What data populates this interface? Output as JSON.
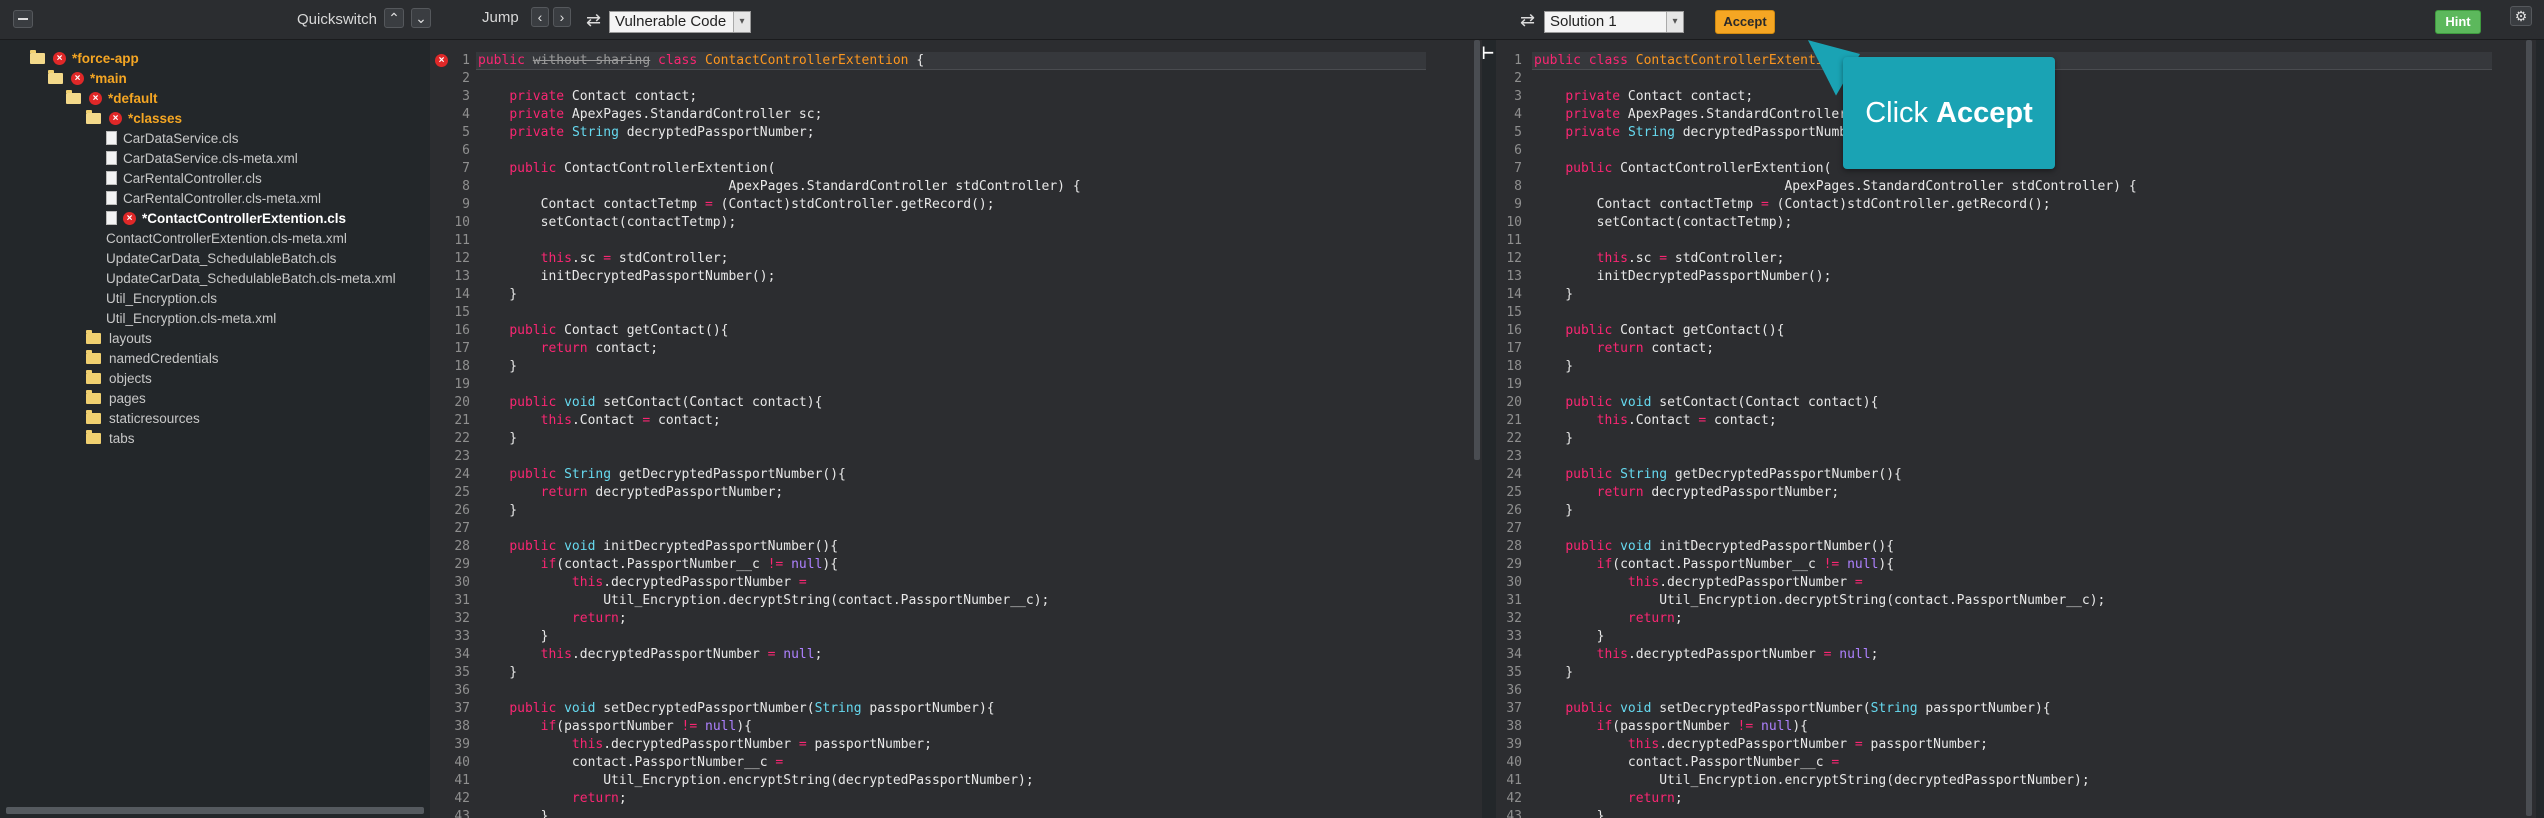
{
  "toolbar": {
    "quickswitch_label": "Quickswitch",
    "jump_label": "Jump",
    "left_select": "Vulnerable Code",
    "right_select": "Solution 1",
    "accept_label": "Accept",
    "hint_label": "Hint"
  },
  "tree": {
    "nodes": [
      {
        "label": "*force-app",
        "depth": 0,
        "kind": "folder",
        "modified": true
      },
      {
        "label": "*main",
        "depth": 1,
        "kind": "folder",
        "modified": true
      },
      {
        "label": "*default",
        "depth": 2,
        "kind": "folder",
        "modified": true
      },
      {
        "label": "*classes",
        "depth": 3,
        "kind": "folder",
        "modified": true
      },
      {
        "label": "CarDataService.cls",
        "depth": 4,
        "kind": "file"
      },
      {
        "label": "CarDataService.cls-meta.xml",
        "depth": 4,
        "kind": "file"
      },
      {
        "label": "CarRentalController.cls",
        "depth": 4,
        "kind": "file"
      },
      {
        "label": "CarRentalController.cls-meta.xml",
        "depth": 4,
        "kind": "file"
      },
      {
        "label": "*ContactControllerExtention.cls",
        "depth": 4,
        "kind": "file",
        "modified": true,
        "active": true
      },
      {
        "label": "ContactControllerExtention.cls-meta.xml",
        "depth": 4,
        "kind": "plain"
      },
      {
        "label": "UpdateCarData_SchedulableBatch.cls",
        "depth": 4,
        "kind": "plain"
      },
      {
        "label": "UpdateCarData_SchedulableBatch.cls-meta.xml",
        "depth": 4,
        "kind": "plain"
      },
      {
        "label": "Util_Encryption.cls",
        "depth": 4,
        "kind": "plain"
      },
      {
        "label": "Util_Encryption.cls-meta.xml",
        "depth": 4,
        "kind": "plain"
      },
      {
        "label": "layouts",
        "depth": 3,
        "kind": "folder"
      },
      {
        "label": "namedCredentials",
        "depth": 3,
        "kind": "folder"
      },
      {
        "label": "objects",
        "depth": 3,
        "kind": "folder"
      },
      {
        "label": "pages",
        "depth": 3,
        "kind": "folder"
      },
      {
        "label": "staticresources",
        "depth": 3,
        "kind": "folder"
      },
      {
        "label": "tabs",
        "depth": 3,
        "kind": "folder"
      }
    ]
  },
  "callout": {
    "prefix": "Click",
    "action": "Accept"
  },
  "left_code": [
    [
      [
        "k",
        "public"
      ],
      [
        "s",
        " "
      ],
      [
        "x",
        "without sharing"
      ],
      [
        "s",
        " "
      ],
      [
        "k",
        "class"
      ],
      [
        "s",
        " "
      ],
      [
        "c",
        "ContactControllerExtention"
      ],
      [
        "s",
        " {"
      ]
    ],
    [],
    [
      [
        "s",
        "    "
      ],
      [
        "k",
        "private"
      ],
      [
        "s",
        " Contact contact;"
      ]
    ],
    [
      [
        "s",
        "    "
      ],
      [
        "k",
        "private"
      ],
      [
        "s",
        " ApexPages.StandardController sc;"
      ]
    ],
    [
      [
        "s",
        "    "
      ],
      [
        "k",
        "private"
      ],
      [
        "s",
        " "
      ],
      [
        "t",
        "String"
      ],
      [
        "s",
        " decryptedPassportNumber;"
      ]
    ],
    [],
    [
      [
        "s",
        "    "
      ],
      [
        "k",
        "public"
      ],
      [
        "s",
        " ContactControllerExtention("
      ]
    ],
    [
      [
        "s",
        "                                ApexPages.StandardController stdController) {"
      ]
    ],
    [
      [
        "s",
        "        Contact contactTetmp "
      ],
      [
        "k",
        "="
      ],
      [
        "s",
        " (Contact)stdController.getRecord();"
      ]
    ],
    [
      [
        "s",
        "        setContact(contactTetmp);"
      ]
    ],
    [],
    [
      [
        "s",
        "        "
      ],
      [
        "k",
        "this"
      ],
      [
        "s",
        ".sc "
      ],
      [
        "k",
        "="
      ],
      [
        "s",
        " stdController;"
      ]
    ],
    [
      [
        "s",
        "        initDecryptedPassportNumber();"
      ]
    ],
    [
      [
        "s",
        "    }"
      ]
    ],
    [],
    [
      [
        "s",
        "    "
      ],
      [
        "k",
        "public"
      ],
      [
        "s",
        " Contact getContact(){"
      ]
    ],
    [
      [
        "s",
        "        "
      ],
      [
        "k",
        "return"
      ],
      [
        "s",
        " contact;"
      ]
    ],
    [
      [
        "s",
        "    }"
      ]
    ],
    [],
    [
      [
        "s",
        "    "
      ],
      [
        "k",
        "public"
      ],
      [
        "s",
        " "
      ],
      [
        "t",
        "void"
      ],
      [
        "s",
        " setContact(Contact contact){"
      ]
    ],
    [
      [
        "s",
        "        "
      ],
      [
        "k",
        "this"
      ],
      [
        "s",
        ".Contact "
      ],
      [
        "k",
        "="
      ],
      [
        "s",
        " contact;"
      ]
    ],
    [
      [
        "s",
        "    }"
      ]
    ],
    [],
    [
      [
        "s",
        "    "
      ],
      [
        "k",
        "public"
      ],
      [
        "s",
        " "
      ],
      [
        "t",
        "String"
      ],
      [
        "s",
        " getDecryptedPassportNumber(){"
      ]
    ],
    [
      [
        "s",
        "        "
      ],
      [
        "k",
        "return"
      ],
      [
        "s",
        " decryptedPassportNumber;"
      ]
    ],
    [
      [
        "s",
        "    }"
      ]
    ],
    [],
    [
      [
        "s",
        "    "
      ],
      [
        "k",
        "public"
      ],
      [
        "s",
        " "
      ],
      [
        "t",
        "void"
      ],
      [
        "s",
        " initDecryptedPassportNumber(){"
      ]
    ],
    [
      [
        "s",
        "        "
      ],
      [
        "k",
        "if"
      ],
      [
        "s",
        "(contact.PassportNumber__c "
      ],
      [
        "k",
        "!="
      ],
      [
        "s",
        " "
      ],
      [
        "n",
        "null"
      ],
      [
        "s",
        "){"
      ]
    ],
    [
      [
        "s",
        "            "
      ],
      [
        "k",
        "this"
      ],
      [
        "s",
        ".decryptedPassportNumber "
      ],
      [
        "k",
        "="
      ]
    ],
    [
      [
        "s",
        "                Util_Encryption.decryptString(contact.PassportNumber__c);"
      ]
    ],
    [
      [
        "s",
        "            "
      ],
      [
        "k",
        "return"
      ],
      [
        "s",
        ";"
      ]
    ],
    [
      [
        "s",
        "        }"
      ]
    ],
    [
      [
        "s",
        "        "
      ],
      [
        "k",
        "this"
      ],
      [
        "s",
        ".decryptedPassportNumber "
      ],
      [
        "k",
        "="
      ],
      [
        "s",
        " "
      ],
      [
        "n",
        "null"
      ],
      [
        "s",
        ";"
      ]
    ],
    [
      [
        "s",
        "    }"
      ]
    ],
    [],
    [
      [
        "s",
        "    "
      ],
      [
        "k",
        "public"
      ],
      [
        "s",
        " "
      ],
      [
        "t",
        "void"
      ],
      [
        "s",
        " setDecryptedPassportNumber("
      ],
      [
        "t",
        "String"
      ],
      [
        "s",
        " passportNumber){"
      ]
    ],
    [
      [
        "s",
        "        "
      ],
      [
        "k",
        "if"
      ],
      [
        "s",
        "(passportNumber "
      ],
      [
        "k",
        "!="
      ],
      [
        "s",
        " "
      ],
      [
        "n",
        "null"
      ],
      [
        "s",
        "){"
      ]
    ],
    [
      [
        "s",
        "            "
      ],
      [
        "k",
        "this"
      ],
      [
        "s",
        ".decryptedPassportNumber "
      ],
      [
        "k",
        "="
      ],
      [
        "s",
        " passportNumber;"
      ]
    ],
    [
      [
        "s",
        "            contact.PassportNumber__c "
      ],
      [
        "k",
        "="
      ]
    ],
    [
      [
        "s",
        "                Util_Encryption.encryptString(decryptedPassportNumber);"
      ]
    ],
    [
      [
        "s",
        "            "
      ],
      [
        "k",
        "return"
      ],
      [
        "s",
        ";"
      ]
    ],
    [
      [
        "s",
        "        }"
      ]
    ]
  ],
  "right_code": [
    [
      [
        "k",
        "public"
      ],
      [
        "s",
        " "
      ],
      [
        "k",
        "class"
      ],
      [
        "s",
        " "
      ],
      [
        "c",
        "ContactControllerExtention"
      ],
      [
        "s",
        " {"
      ]
    ],
    [],
    [
      [
        "s",
        "    "
      ],
      [
        "k",
        "private"
      ],
      [
        "s",
        " Contact contact;"
      ]
    ],
    [
      [
        "s",
        "    "
      ],
      [
        "k",
        "private"
      ],
      [
        "s",
        " ApexPages.StandardController sc;"
      ]
    ],
    [
      [
        "s",
        "    "
      ],
      [
        "k",
        "private"
      ],
      [
        "s",
        " "
      ],
      [
        "t",
        "String"
      ],
      [
        "s",
        " decryptedPassportNumber;"
      ]
    ],
    [],
    [
      [
        "s",
        "    "
      ],
      [
        "k",
        "public"
      ],
      [
        "s",
        " ContactControllerExtention("
      ]
    ],
    [
      [
        "s",
        "                                ApexPages.StandardController stdController) {"
      ]
    ],
    [
      [
        "s",
        "        Contact contactTetmp "
      ],
      [
        "k",
        "="
      ],
      [
        "s",
        " (Contact)stdController.getRecord();"
      ]
    ],
    [
      [
        "s",
        "        setContact(contactTetmp);"
      ]
    ],
    [],
    [
      [
        "s",
        "        "
      ],
      [
        "k",
        "this"
      ],
      [
        "s",
        ".sc "
      ],
      [
        "k",
        "="
      ],
      [
        "s",
        " stdController;"
      ]
    ],
    [
      [
        "s",
        "        initDecryptedPassportNumber();"
      ]
    ],
    [
      [
        "s",
        "    }"
      ]
    ],
    [],
    [
      [
        "s",
        "    "
      ],
      [
        "k",
        "public"
      ],
      [
        "s",
        " Contact getContact(){"
      ]
    ],
    [
      [
        "s",
        "        "
      ],
      [
        "k",
        "return"
      ],
      [
        "s",
        " contact;"
      ]
    ],
    [
      [
        "s",
        "    }"
      ]
    ],
    [],
    [
      [
        "s",
        "    "
      ],
      [
        "k",
        "public"
      ],
      [
        "s",
        " "
      ],
      [
        "t",
        "void"
      ],
      [
        "s",
        " setContact(Contact contact){"
      ]
    ],
    [
      [
        "s",
        "        "
      ],
      [
        "k",
        "this"
      ],
      [
        "s",
        ".Contact "
      ],
      [
        "k",
        "="
      ],
      [
        "s",
        " contact;"
      ]
    ],
    [
      [
        "s",
        "    }"
      ]
    ],
    [],
    [
      [
        "s",
        "    "
      ],
      [
        "k",
        "public"
      ],
      [
        "s",
        " "
      ],
      [
        "t",
        "String"
      ],
      [
        "s",
        " getDecryptedPassportNumber(){"
      ]
    ],
    [
      [
        "s",
        "        "
      ],
      [
        "k",
        "return"
      ],
      [
        "s",
        " decryptedPassportNumber;"
      ]
    ],
    [
      [
        "s",
        "    }"
      ]
    ],
    [],
    [
      [
        "s",
        "    "
      ],
      [
        "k",
        "public"
      ],
      [
        "s",
        " "
      ],
      [
        "t",
        "void"
      ],
      [
        "s",
        " initDecryptedPassportNumber(){"
      ]
    ],
    [
      [
        "s",
        "        "
      ],
      [
        "k",
        "if"
      ],
      [
        "s",
        "(contact.PassportNumber__c "
      ],
      [
        "k",
        "!="
      ],
      [
        "s",
        " "
      ],
      [
        "n",
        "null"
      ],
      [
        "s",
        "){"
      ]
    ],
    [
      [
        "s",
        "            "
      ],
      [
        "k",
        "this"
      ],
      [
        "s",
        ".decryptedPassportNumber "
      ],
      [
        "k",
        "="
      ]
    ],
    [
      [
        "s",
        "                Util_Encryption.decryptString(contact.PassportNumber__c);"
      ]
    ],
    [
      [
        "s",
        "            "
      ],
      [
        "k",
        "return"
      ],
      [
        "s",
        ";"
      ]
    ],
    [
      [
        "s",
        "        }"
      ]
    ],
    [
      [
        "s",
        "        "
      ],
      [
        "k",
        "this"
      ],
      [
        "s",
        ".decryptedPassportNumber "
      ],
      [
        "k",
        "="
      ],
      [
        "s",
        " "
      ],
      [
        "n",
        "null"
      ],
      [
        "s",
        ";"
      ]
    ],
    [
      [
        "s",
        "    }"
      ]
    ],
    [],
    [
      [
        "s",
        "    "
      ],
      [
        "k",
        "public"
      ],
      [
        "s",
        " "
      ],
      [
        "t",
        "void"
      ],
      [
        "s",
        " setDecryptedPassportNumber("
      ],
      [
        "t",
        "String"
      ],
      [
        "s",
        " passportNumber){"
      ]
    ],
    [
      [
        "s",
        "        "
      ],
      [
        "k",
        "if"
      ],
      [
        "s",
        "(passportNumber "
      ],
      [
        "k",
        "!="
      ],
      [
        "s",
        " "
      ],
      [
        "n",
        "null"
      ],
      [
        "s",
        "){"
      ]
    ],
    [
      [
        "s",
        "            "
      ],
      [
        "k",
        "this"
      ],
      [
        "s",
        ".decryptedPassportNumber "
      ],
      [
        "k",
        "="
      ],
      [
        "s",
        " passportNumber;"
      ]
    ],
    [
      [
        "s",
        "            contact.PassportNumber__c "
      ],
      [
        "k",
        "="
      ]
    ],
    [
      [
        "s",
        "                Util_Encryption.encryptString(decryptedPassportNumber);"
      ]
    ],
    [
      [
        "s",
        "            "
      ],
      [
        "k",
        "return"
      ],
      [
        "s",
        ";"
      ]
    ],
    [
      [
        "s",
        "        }"
      ]
    ]
  ]
}
